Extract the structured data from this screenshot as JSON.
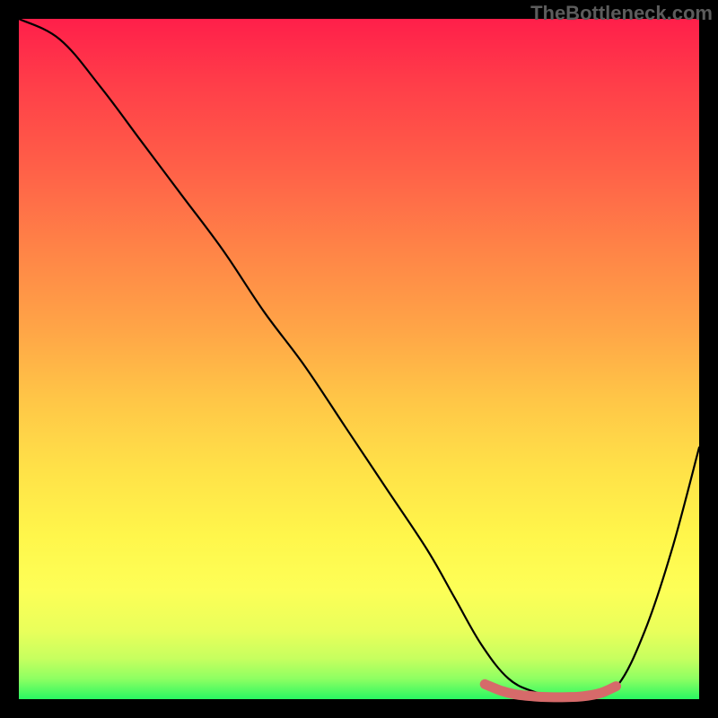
{
  "watermark": "TheBottleneck.com",
  "colors": {
    "frame_bg": "#000000",
    "gradient_top": "#ff1f4a",
    "gradient_bottom": "#29f762",
    "main_curve": "#000000",
    "marker_stroke": "#d66a6a"
  },
  "chart_data": {
    "type": "line",
    "title": "",
    "xlabel": "",
    "ylabel": "",
    "xlim": [
      0,
      100
    ],
    "ylim": [
      0,
      100
    ],
    "series": [
      {
        "name": "main-curve",
        "x": [
          0,
          6,
          12,
          18,
          24,
          30,
          36,
          42,
          48,
          54,
          60,
          64,
          68,
          72,
          76,
          80,
          84,
          88,
          92,
          96,
          100
        ],
        "values": [
          100,
          97,
          90,
          82,
          74,
          66,
          57,
          49,
          40,
          31,
          22,
          15,
          8,
          3,
          1,
          0,
          0,
          2,
          10,
          22,
          37
        ]
      },
      {
        "name": "bottom-markers",
        "x": [
          68.5,
          71.0,
          73.0,
          75.8,
          78.0,
          80.5,
          82.8,
          85.5,
          87.8
        ],
        "values": [
          2.2,
          1.2,
          0.7,
          0.4,
          0.3,
          0.3,
          0.4,
          0.9,
          1.9
        ]
      }
    ]
  }
}
